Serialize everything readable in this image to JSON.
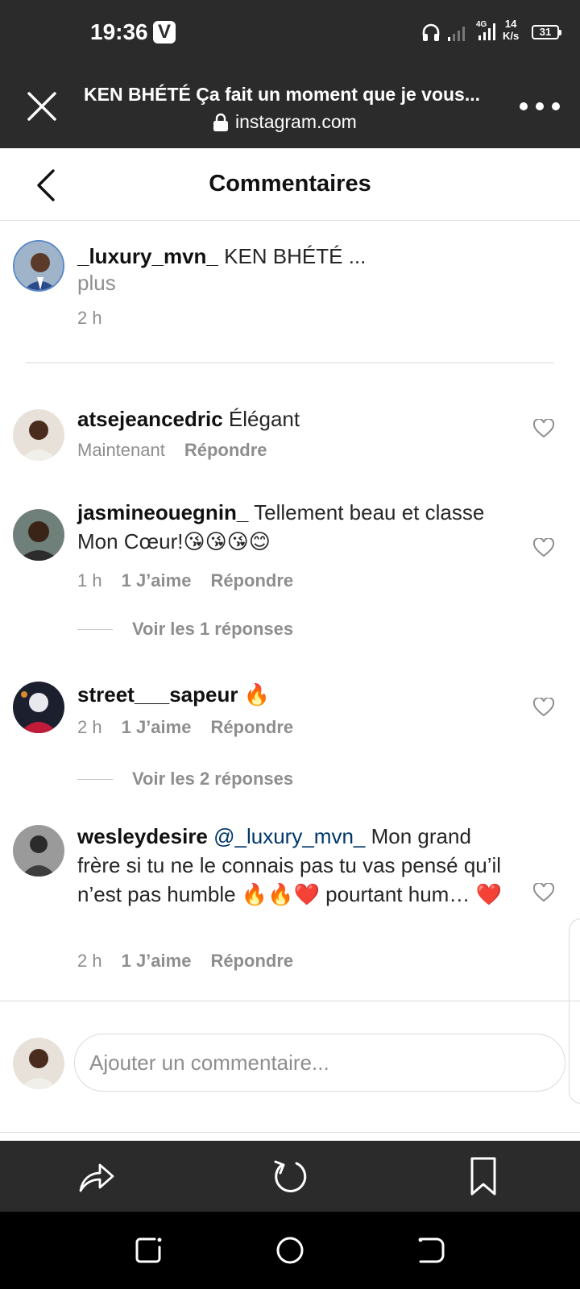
{
  "status_bar": {
    "time": "19:36",
    "app_badge": "V",
    "network_type": "4G",
    "speed_value": "14",
    "speed_unit": "K/s",
    "battery": "31"
  },
  "browser": {
    "title": "KEN BHÉTÉ Ça fait un moment que je vous...",
    "domain": "instagram.com"
  },
  "header": {
    "title": "Commentaires"
  },
  "caption": {
    "username": "_luxury_mvn_",
    "text": "KEN BHÉTÉ ...",
    "more": "plus",
    "time": "2 h"
  },
  "comments": [
    {
      "username": "atsejeancedric",
      "text": "Élégant",
      "time": "Maintenant",
      "likes": "",
      "reply": "Répondre"
    },
    {
      "username": "jasmineouegnin_",
      "text": "Tellement beau et classe Mon Cœur!😘😘😘😊",
      "time": "1 h",
      "likes": "1 J’aime",
      "reply": "Répondre",
      "replies_label": "Voir les 1 réponses"
    },
    {
      "username": "street___sapeur",
      "text": "🔥",
      "time": "2 h",
      "likes": "1 J’aime",
      "reply": "Répondre",
      "replies_label": "Voir les 2 réponses"
    },
    {
      "username": "wesleydesire",
      "mention": "@_luxury_mvn_",
      "text": "Mon grand frère si tu ne le connais pas tu vas pensé qu’il n’est pas humble 🔥🔥❤️ pourtant hum… ❤️",
      "time": "2 h",
      "likes": "1 J’aime",
      "reply": "Répondre"
    }
  ],
  "compose": {
    "placeholder": "Ajouter un commentaire..."
  },
  "colors": {
    "chrome_dark": "#2b2b2b",
    "text_primary": "#262626",
    "text_secondary": "#8e8e8e",
    "mention": "#00376b",
    "divider": "#dbdbdb"
  }
}
